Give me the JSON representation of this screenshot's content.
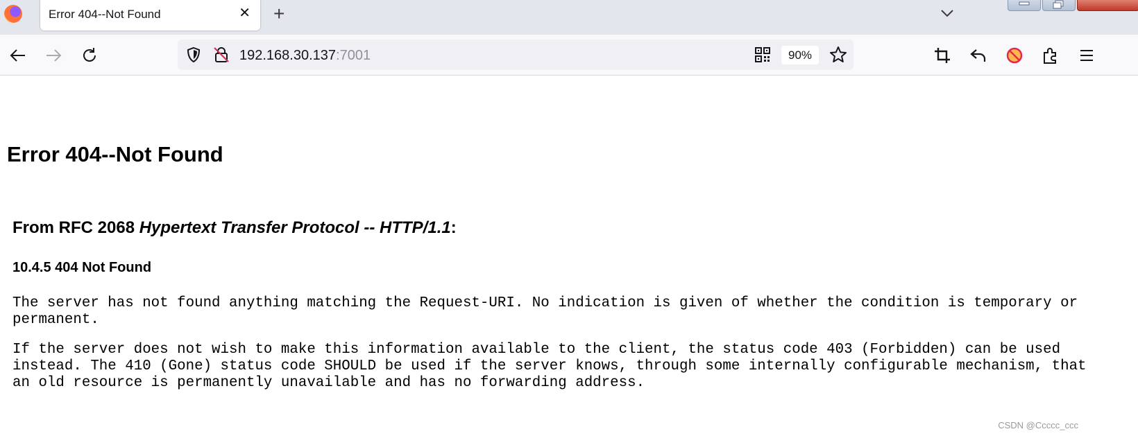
{
  "browser": {
    "tab": {
      "title": "Error 404--Not Found",
      "close_glyph": "✕"
    },
    "new_tab_glyph": "+",
    "url": {
      "host": "192.168.30.137",
      "port": ":7001"
    },
    "zoom": "90%"
  },
  "page": {
    "heading": "Error 404--Not Found",
    "rfc_prefix": "From RFC 2068 ",
    "rfc_title": "Hypertext Transfer Protocol -- HTTP/1.1",
    "rfc_suffix": ":",
    "section": "10.4.5 404 Not Found",
    "para1_line1": "The server has not found anything matching the Request-URI. No indication is given of whether the condition is temporary or",
    "para1_line2": "permanent.",
    "para2_line1": "If the server does not wish to make this information available to the client, the status code 403 (Forbidden) can be used",
    "para2_line2": "instead. The 410 (Gone) status code SHOULD be used if the server knows, through some internally configurable mechanism, that",
    "para2_line3": "an old resource is permanently unavailable and has no forwarding address."
  },
  "watermark": "CSDN @Ccccc_ccc",
  "icons": [
    "firefox-logo-icon",
    "close-icon",
    "plus-icon",
    "chevron-down-icon",
    "back-arrow-icon",
    "forward-arrow-icon",
    "reload-icon",
    "shield-icon",
    "insecure-lock-icon",
    "qr-code-icon",
    "star-icon",
    "crop-icon",
    "undo-arrow-icon",
    "blocked-extension-icon",
    "extensions-puzzle-icon",
    "menu-icon"
  ]
}
